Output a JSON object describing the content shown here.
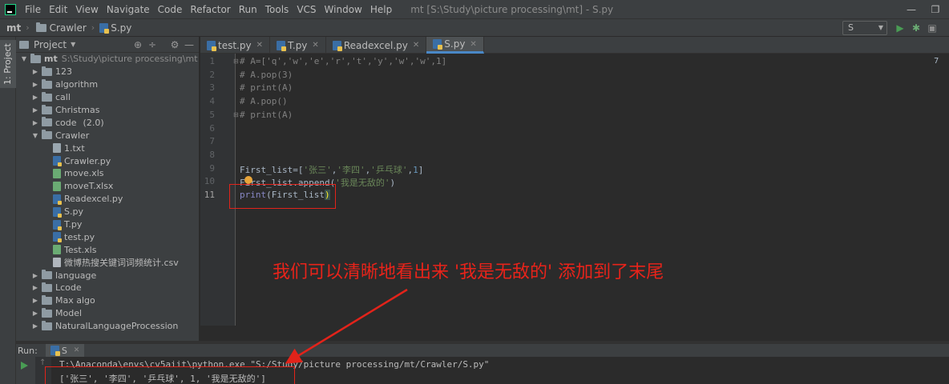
{
  "titlebar": {
    "menu": [
      "File",
      "Edit",
      "View",
      "Navigate",
      "Code",
      "Refactor",
      "Run",
      "Tools",
      "VCS",
      "Window",
      "Help"
    ],
    "window_title": "mt [S:\\Study\\picture processing\\mt] - S.py"
  },
  "navbar": {
    "crumbs": [
      "mt",
      "Crawler",
      "S.py"
    ],
    "run_config": "S"
  },
  "left_strip": {
    "label": "1: Project"
  },
  "project_panel": {
    "title": "Project",
    "root": {
      "name": "mt",
      "path": "S:\\Study\\picture processing\\mt"
    },
    "items": [
      {
        "name": "123",
        "type": "folder",
        "level": 1,
        "expanded": false
      },
      {
        "name": "algorithm",
        "type": "folder",
        "level": 1,
        "expanded": false
      },
      {
        "name": "call",
        "type": "folder",
        "level": 1,
        "expanded": false
      },
      {
        "name": "Christmas",
        "type": "folder",
        "level": 1,
        "expanded": false
      },
      {
        "name": "code",
        "type": "folder",
        "level": 1,
        "expanded": false,
        "hint": "(2.0)"
      },
      {
        "name": "Crawler",
        "type": "folder",
        "level": 1,
        "expanded": true
      },
      {
        "name": "1.txt",
        "type": "txt",
        "level": 2
      },
      {
        "name": "Crawler.py",
        "type": "py",
        "level": 2
      },
      {
        "name": "move.xls",
        "type": "xls",
        "level": 2
      },
      {
        "name": "moveT.xlsx",
        "type": "xls",
        "level": 2
      },
      {
        "name": "Readexcel.py",
        "type": "py",
        "level": 2
      },
      {
        "name": "S.py",
        "type": "py",
        "level": 2
      },
      {
        "name": "T.py",
        "type": "py",
        "level": 2
      },
      {
        "name": "test.py",
        "type": "py",
        "level": 2
      },
      {
        "name": "Test.xls",
        "type": "xls",
        "level": 2
      },
      {
        "name": "微博热搜关键词词频统计.csv",
        "type": "csv",
        "level": 2
      },
      {
        "name": "language",
        "type": "folder",
        "level": 1,
        "expanded": false
      },
      {
        "name": "Lcode",
        "type": "folder",
        "level": 1,
        "expanded": false
      },
      {
        "name": "Max algo",
        "type": "folder",
        "level": 1,
        "expanded": false
      },
      {
        "name": "Model",
        "type": "folder",
        "level": 1,
        "expanded": false
      },
      {
        "name": "NaturalLanguageProcession",
        "type": "folder",
        "level": 1,
        "expanded": false
      }
    ]
  },
  "editor_tabs": [
    {
      "label": "test.py",
      "active": false
    },
    {
      "label": "T.py",
      "active": false
    },
    {
      "label": "Readexcel.py",
      "active": false
    },
    {
      "label": "S.py",
      "active": true
    }
  ],
  "editor": {
    "current_line": 11,
    "line_numbers": [
      "1",
      "2",
      "3",
      "4",
      "5",
      "6",
      "7",
      "8",
      "9",
      "10",
      "11"
    ],
    "lines": [
      "# A=['q','w','e','r','t','y','w','w',1]",
      "# A.pop(3)",
      "# print(A)",
      "# A.pop()",
      "# print(A)",
      "",
      "",
      "",
      "First_list=['张三','李四','乒乓球',1]",
      "First_list.append('我是无敌的')",
      "print(First_list)"
    ],
    "right_marker": "7"
  },
  "annotation": {
    "text": "我们可以清晰地看出来 '我是无敌的' 添加到了末尾",
    "color": "#e8231a"
  },
  "run_panel": {
    "label": "Run:",
    "tab": "S",
    "console": [
      "T:\\Anaconda\\envs\\cv5aiit\\python.exe \"S:/Study/picture processing/mt/Crawler/S.py\"",
      "['张三', '李四', '乒乓球', 1, '我是无敌的']"
    ]
  },
  "colors": {
    "bg": "#2b2b2b",
    "panel": "#3c3f41",
    "comment": "#808080",
    "string": "#6a8759",
    "number": "#6897bb",
    "builtin": "#8888c6",
    "annotation_red": "#e2231a",
    "run_green": "#499c54"
  }
}
